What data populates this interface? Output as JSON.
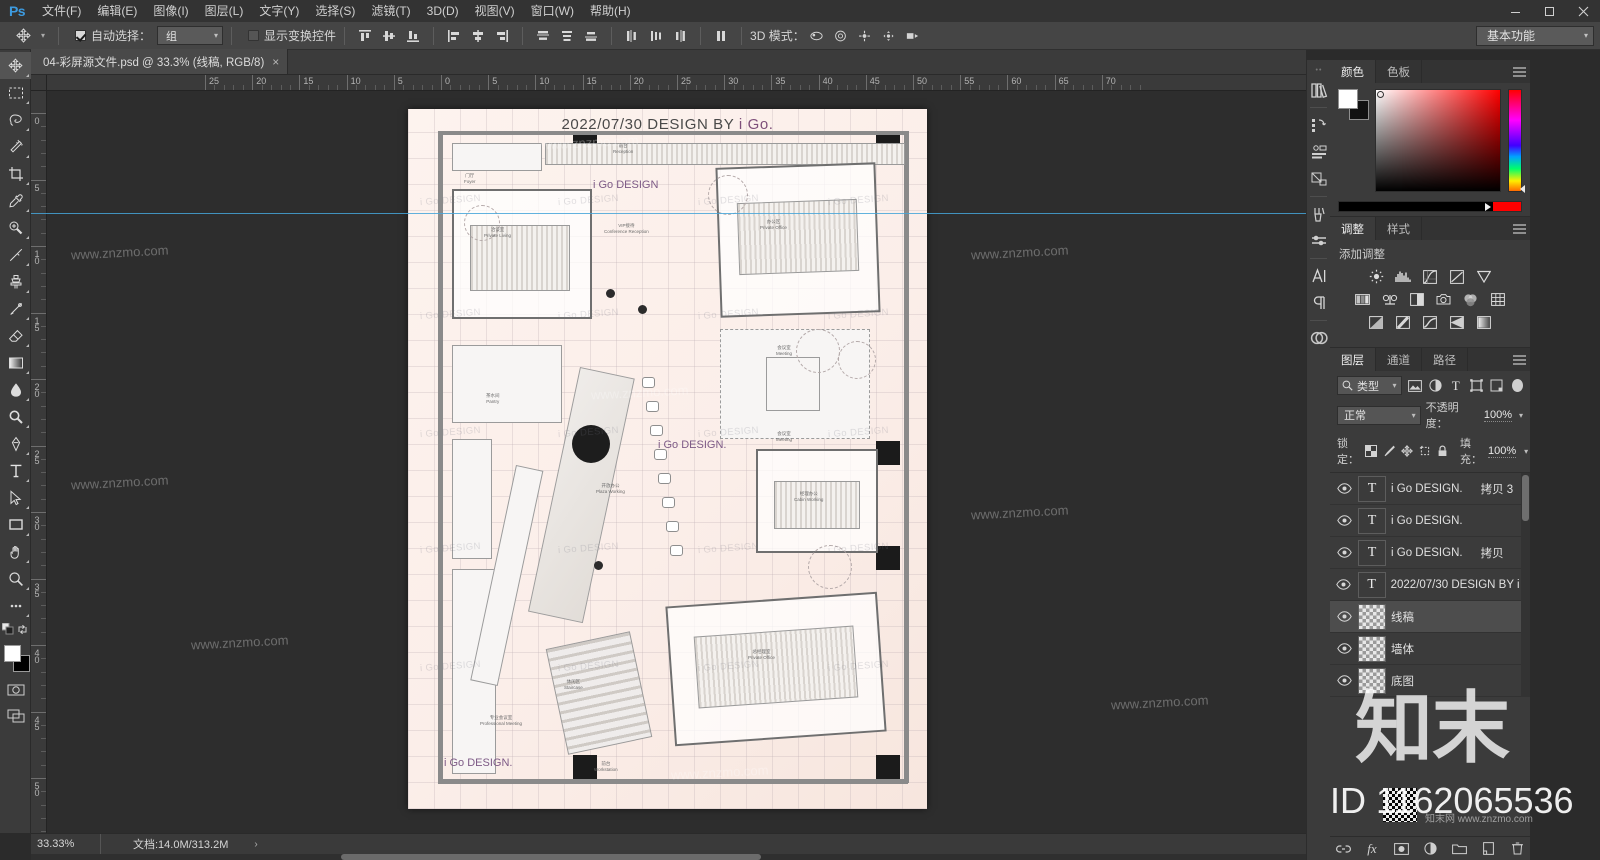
{
  "app": {
    "logo": "Ps",
    "title_bar_buttons": [
      "minimize",
      "restore",
      "close"
    ]
  },
  "menubar": {
    "items": [
      {
        "label": "文件(F)",
        "name": "menu-file"
      },
      {
        "label": "编辑(E)",
        "name": "menu-edit"
      },
      {
        "label": "图像(I)",
        "name": "menu-image"
      },
      {
        "label": "图层(L)",
        "name": "menu-layer"
      },
      {
        "label": "文字(Y)",
        "name": "menu-type"
      },
      {
        "label": "选择(S)",
        "name": "menu-select"
      },
      {
        "label": "滤镜(T)",
        "name": "menu-filter"
      },
      {
        "label": "3D(D)",
        "name": "menu-3d"
      },
      {
        "label": "视图(V)",
        "name": "menu-view"
      },
      {
        "label": "窗口(W)",
        "name": "menu-window"
      },
      {
        "label": "帮助(H)",
        "name": "menu-help"
      }
    ]
  },
  "options_bar": {
    "tool_icon": "move-tool-icon",
    "auto_select_checked": true,
    "auto_select_label": "自动选择：",
    "auto_select_value": "组",
    "show_transform_checked": false,
    "show_transform_label": "显示变换控件",
    "mode_3d_label": "3D 模式：",
    "workspace": "基本功能",
    "align_buttons": [
      "align-top-edges",
      "align-vertical-centers",
      "align-bottom-edges",
      "align-left-edges",
      "align-horizontal-centers",
      "align-right-edges"
    ],
    "distribute_buttons": [
      "distribute-top-edges",
      "distribute-vertical-centers",
      "distribute-bottom-edges",
      "distribute-left-edges",
      "distribute-horizontal-centers",
      "distribute-right-edges"
    ],
    "extra_buttons": [
      "auto-align-layers"
    ],
    "mode_3d_buttons": [
      "rotate-3d-icon",
      "roll-3d-icon",
      "pan-3d-icon",
      "slide-3d-icon",
      "scale-3d-icon"
    ]
  },
  "toolbar": {
    "tools": [
      {
        "name": "move-tool",
        "selected": true
      },
      {
        "name": "rectangular-marquee-tool",
        "selected": false
      },
      {
        "name": "lasso-tool",
        "selected": false
      },
      {
        "name": "magic-wand-tool",
        "selected": false
      },
      {
        "name": "crop-tool",
        "selected": false
      },
      {
        "name": "eyedropper-tool",
        "selected": false
      },
      {
        "name": "spot-healing-brush-tool",
        "selected": false
      },
      {
        "name": "brush-tool",
        "selected": false
      },
      {
        "name": "clone-stamp-tool",
        "selected": false
      },
      {
        "name": "history-brush-tool",
        "selected": false
      },
      {
        "name": "eraser-tool",
        "selected": false
      },
      {
        "name": "gradient-tool",
        "selected": false
      },
      {
        "name": "blur-tool",
        "selected": false
      },
      {
        "name": "dodge-tool",
        "selected": false
      },
      {
        "name": "pen-tool",
        "selected": false
      },
      {
        "name": "horizontal-type-tool",
        "selected": false
      },
      {
        "name": "path-selection-tool",
        "selected": false
      },
      {
        "name": "rectangle-tool",
        "selected": false
      },
      {
        "name": "hand-tool",
        "selected": false
      },
      {
        "name": "zoom-tool",
        "selected": false
      },
      {
        "name": "edit-toolbar-tool",
        "selected": false
      }
    ],
    "foreground_color": "#ffffff",
    "background_color": "#000000",
    "quick_mask": "quick-mask-icon",
    "screen_mode": "screen-mode-icon"
  },
  "document_tab": {
    "title": "04-彩屏源文件.psd @ 33.3% (线稿, RGB/8)",
    "close": "×"
  },
  "rulers": {
    "horizontal_ticks": [
      "25",
      "20",
      "15",
      "10",
      "5",
      "0",
      "5",
      "10",
      "15",
      "20",
      "25",
      "30",
      "35",
      "40",
      "45",
      "50",
      "55",
      "60",
      "65"
    ],
    "vertical_ticks": [
      "0",
      "5",
      "10",
      "15",
      "20",
      "25",
      "30",
      "35",
      "40",
      "45",
      "50"
    ],
    "unit": "cm"
  },
  "canvas": {
    "artwork_title": "2022/07/30 DESIGN BY i Go.",
    "artwork_title_plain": "2022/07/30 DESIGN BY ",
    "artwork_title_brand": "i Go.",
    "watermark_text": "www.znzmo.com",
    "brand_marks": [
      "i Go DESIGN",
      "i Go DESIGN.",
      "i Go DESIGN."
    ],
    "plan_labels": [
      {
        "cn": "门厅",
        "en": "Foyer"
      },
      {
        "cn": "接待",
        "en": "Reception"
      },
      {
        "cn": "洽谈室",
        "en": "Private Living"
      },
      {
        "cn": "办公区",
        "en": "Private Office"
      },
      {
        "cn": "VIP接待",
        "en": "Conference Reception"
      },
      {
        "cn": "茶水间",
        "en": "Pantry"
      },
      {
        "cn": "会议室",
        "en": "Meeting Room"
      },
      {
        "cn": "开放办公",
        "en": "Plaza Working"
      },
      {
        "cn": "经理办公",
        "en": "Cabin Working"
      },
      {
        "cn": "休闲区",
        "en": "Staircase"
      },
      {
        "cn": "专业会议室",
        "en": "Professional Meeting"
      },
      {
        "cn": "总经理室",
        "en": "Private Office"
      },
      {
        "cn": "前台",
        "en": "Workstation"
      }
    ]
  },
  "status_bar": {
    "zoom": "33.33%",
    "doc_info": "文档:14.0M/313.2M",
    "expand": "›"
  },
  "icon_dock": {
    "items": [
      "libraries-icon",
      "history-icon",
      "actions-icon",
      "properties-icon",
      "brush-settings-icon",
      "brush-presets-icon",
      "character-icon",
      "paragraph-icon"
    ],
    "cc_icon": "creative-cloud-icon"
  },
  "color_panel": {
    "tabs": [
      {
        "label": "颜色",
        "active": true
      },
      {
        "label": "色板",
        "active": false
      }
    ],
    "menu": "panel-menu-icon",
    "foreground": "#ffffff",
    "background": "#000000",
    "spectrum_accent": "#ff0000"
  },
  "adjustments_panel": {
    "tabs": [
      {
        "label": "调整",
        "active": true
      },
      {
        "label": "样式",
        "active": false
      }
    ],
    "menu": "panel-menu-icon",
    "heading": "添加调整",
    "row1": [
      "brightness-contrast-icon",
      "levels-icon",
      "curves-icon",
      "exposure-icon",
      "vibrance-icon"
    ],
    "row2": [
      "hue-saturation-icon",
      "color-balance-icon",
      "black-white-icon",
      "photo-filter-icon",
      "channel-mixer-icon",
      "color-lookup-icon"
    ],
    "row3": [
      "invert-icon",
      "posterize-icon",
      "threshold-icon",
      "gradient-map-icon",
      "selective-color-icon"
    ]
  },
  "layers_panel": {
    "tabs": [
      {
        "label": "图层",
        "active": true
      },
      {
        "label": "通道",
        "active": false
      },
      {
        "label": "路径",
        "active": false
      }
    ],
    "menu": "panel-menu-icon",
    "filter": {
      "icon": "search-icon",
      "value": "类型",
      "caret": "▾",
      "type_icons": [
        "filter-pixel-icon",
        "filter-adjustment-icon",
        "filter-type-icon",
        "filter-shape-icon",
        "filter-smart-object-icon"
      ],
      "toggle": "filter-toggle"
    },
    "blend_mode": "正常",
    "opacity_label": "不透明度：",
    "opacity_value": "100%",
    "lock_label": "锁定：",
    "lock_icons": [
      "lock-transparent-pixels-icon",
      "lock-image-pixels-icon",
      "lock-position-icon",
      "lock-artboard-icon",
      "lock-all-icon"
    ],
    "fill_label": "填充：",
    "fill_value": "100%",
    "rows": [
      {
        "visible": true,
        "kind": "text",
        "thumb": "T",
        "name": "i Go DESIGN.",
        "suffix": "拷贝 3",
        "selected": false
      },
      {
        "visible": true,
        "kind": "text",
        "thumb": "T",
        "name": "i Go DESIGN.",
        "suffix": "",
        "selected": false
      },
      {
        "visible": true,
        "kind": "text",
        "thumb": "T",
        "name": "i Go DESIGN.",
        "suffix": "拷贝",
        "selected": false
      },
      {
        "visible": true,
        "kind": "text",
        "thumb": "T",
        "name": "2022/07/30 DESIGN BY i ...",
        "suffix": "",
        "selected": false
      },
      {
        "visible": true,
        "kind": "pixel",
        "thumb": "",
        "name": "线稿",
        "suffix": "",
        "selected": true
      },
      {
        "visible": true,
        "kind": "pixel",
        "thumb": "",
        "name": "墙体",
        "suffix": "",
        "selected": false
      },
      {
        "visible": true,
        "kind": "pixel",
        "thumb": "",
        "name": "底图",
        "suffix": "",
        "selected": false
      }
    ],
    "footer_icons": [
      "link-layers-icon",
      "layer-style-fx-icon",
      "layer-mask-icon",
      "adjustment-layer-icon",
      "new-group-icon",
      "new-layer-icon",
      "delete-layer-icon"
    ]
  },
  "watermarks": {
    "big_text": "知末",
    "id_text": "ID 1162065536",
    "site": "知末网 www.znzmo.com",
    "qr": "qr-code-icon"
  }
}
